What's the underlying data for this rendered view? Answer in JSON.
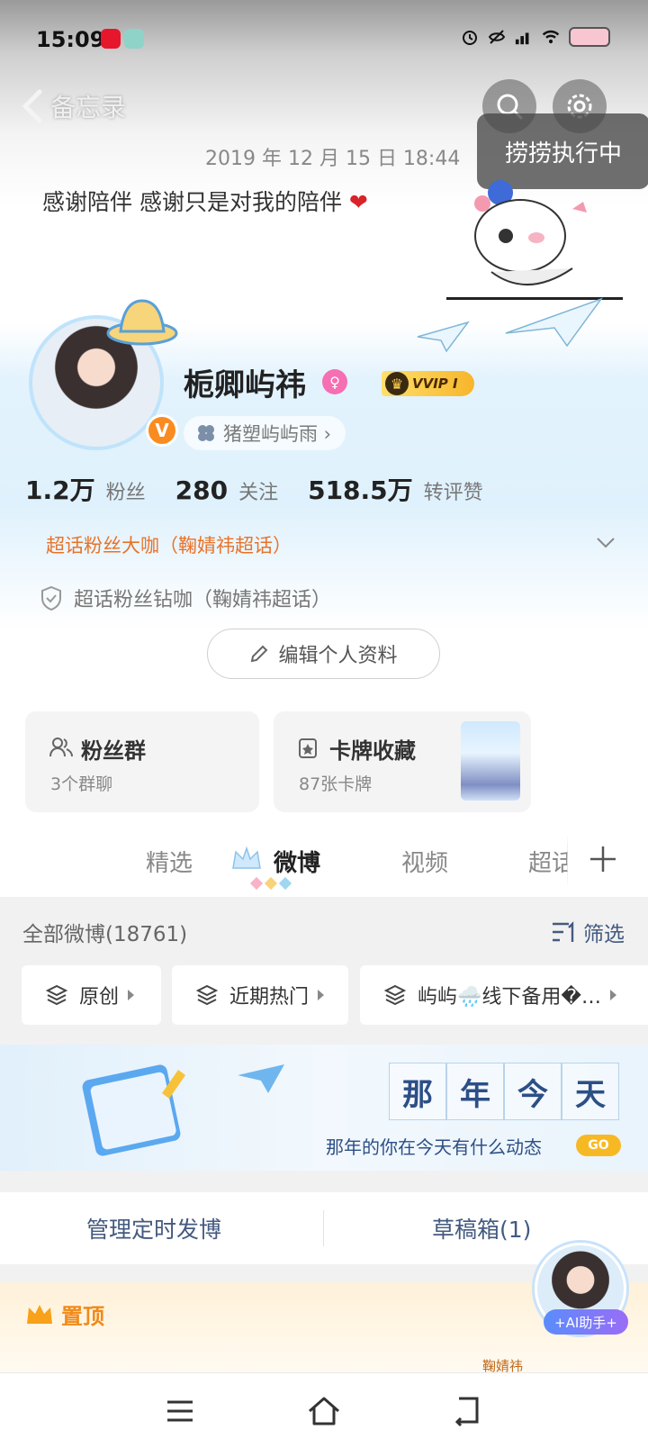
{
  "status_bar": {
    "time": "15:09"
  },
  "nav": {
    "back_label": "备忘录"
  },
  "floating_tag": "捞捞执行中",
  "post": {
    "date": "2019 年 12 月 15 日 18:44",
    "text": "感谢陪伴 感谢只是对我的陪伴",
    "heart": "❤"
  },
  "profile": {
    "username": "栀卿屿祎",
    "verify": "V",
    "vip": "VVIP Ⅰ",
    "sub_tag": "猪塑屿屿雨 ›",
    "stats": [
      {
        "num": "1.2万",
        "label": "粉丝"
      },
      {
        "num": "280",
        "label": "关注"
      },
      {
        "num": "518.5万",
        "label": "转评赞"
      }
    ],
    "superfan_primary": "超话粉丝大咖（鞠婧祎超话）",
    "superfan_secondary": "超话粉丝钻咖（鞠婧祎超话）",
    "edit_button": "编辑个人资料"
  },
  "cards": [
    {
      "title": "粉丝群",
      "sub": "3个群聊"
    },
    {
      "title": "卡牌收藏",
      "sub": "87张卡牌"
    }
  ],
  "tabs": [
    {
      "label": "精选"
    },
    {
      "label": "微博"
    },
    {
      "label": "视频"
    },
    {
      "label": "超话"
    }
  ],
  "list": {
    "header": "全部微博(18761)",
    "filter": "筛选",
    "chips": [
      "原创",
      "近期热门",
      "屿屿🌧️线下备用�…"
    ]
  },
  "banner": {
    "chars": [
      "那",
      "年",
      "今",
      "天"
    ],
    "sub": "那年的你在今天有什么动态",
    "go": "GO"
  },
  "actions": {
    "scheduled": "管理定时发博",
    "drafts": "草稿箱(1)"
  },
  "pinned": {
    "label": "置顶",
    "tag": "鞠婧祎"
  },
  "ai_assistant": "+AI助手+",
  "colors": {
    "accent_orange": "#f08a1a",
    "link_blue": "#445a80",
    "vip_gold": "#f7b52b"
  }
}
